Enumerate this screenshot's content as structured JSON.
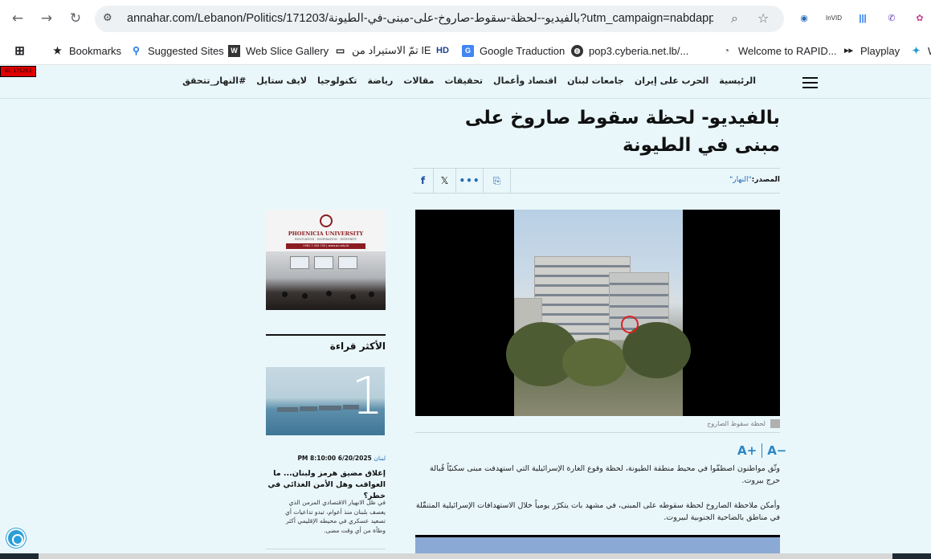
{
  "browser": {
    "url_host": "annahar.com",
    "url_rest": "/Lebanon/Politics/171203/بالفيديو--لحظة-سقوط-صاروخ-على-مبنى-في-الطيونة?utm_campaign=nabdapp.c...",
    "bookmarks": [
      {
        "label": "Bookmarks",
        "icon": "star-icon"
      },
      {
        "label": "Suggested Sites",
        "icon": "search-icon"
      },
      {
        "label": "Web Slice Gallery",
        "icon": "web-slice-icon"
      },
      {
        "label": "تمّ الاستيراد من IE",
        "icon": "folder-icon"
      },
      {
        "label": "",
        "icon": "hd-icon",
        "text": "HD"
      },
      {
        "label": "Google Traduction",
        "icon": "google-translate-icon"
      },
      {
        "label": "pop3.cyberia.net.lb/...",
        "icon": "globe-icon"
      },
      {
        "label": "Welcome to RAPID...",
        "icon": "rapid-icon"
      },
      {
        "label": "Playplay",
        "icon": "playplay-icon"
      }
    ]
  },
  "site": {
    "id_badge": "ID: 171203",
    "nav": [
      "الرئيسية",
      "الحرب على إيران",
      "جامعات لبنان",
      "اقتصاد وأعمال",
      "تحقيقات",
      "مقالات",
      "رياضة",
      "تكنولوجيا",
      "لايف ستايل",
      "#النهار_تتحقق"
    ]
  },
  "article": {
    "title": "بالفيديو- لحظة سقوط صاروخ على مبنى في الطيونة",
    "source_label": "المصدر:",
    "source_name": "\"النهار\"",
    "caption": "لحظة سقوط الصاروخ",
    "font_increase": "A+",
    "font_decrease": "A−",
    "paragraph_1": "وثّق مواطنون اصطفّوا في محيط منطقة الطيونة، لحظة وقوع الغارة الإسرائيلية التي استهدفت مبنى سكنيّاً قُبالة حرج بيروت.",
    "paragraph_2": "وأمكن ملاحظة الصاروخ لحظة سقوطه على المبنى، في مشهد بات يتكرّر يومياً خلال الاستهدافات الإسرائيلية المتنقّلة في مناطق بالضاحية الجنوبية لبيروت."
  },
  "sidebar": {
    "ad": {
      "name": "PHOENICIA UNIVERSITY",
      "tagline": "INNOVATION · INSPIRATION · INTEGRITY",
      "contact": "+961 7 420 720 | www.pu.edu.lb"
    },
    "most_read_title": "الأكثر قراءة",
    "item": {
      "rank": "1",
      "category": "لبنان",
      "datetime": "6/20/2025 8:10:00 PM",
      "headline": "إغلاق مضيق هرمز ولبنان... ما العواقب وهل الأمن الغذائي في خطر؟",
      "summary": "في ظل الانهيار الاقتصادي المزمن الذي يعصف بلبنان منذ أعوام، تبدو تداعيات أي تصعيد عسكري في محيطه الإقليمي أكثر وطأة من أي وقت مضى."
    }
  },
  "colors": {
    "page_bg": "#e9f7fb",
    "accent": "#2b86c5",
    "link": "#2a6db5",
    "brand_red": "#8b1d22"
  }
}
